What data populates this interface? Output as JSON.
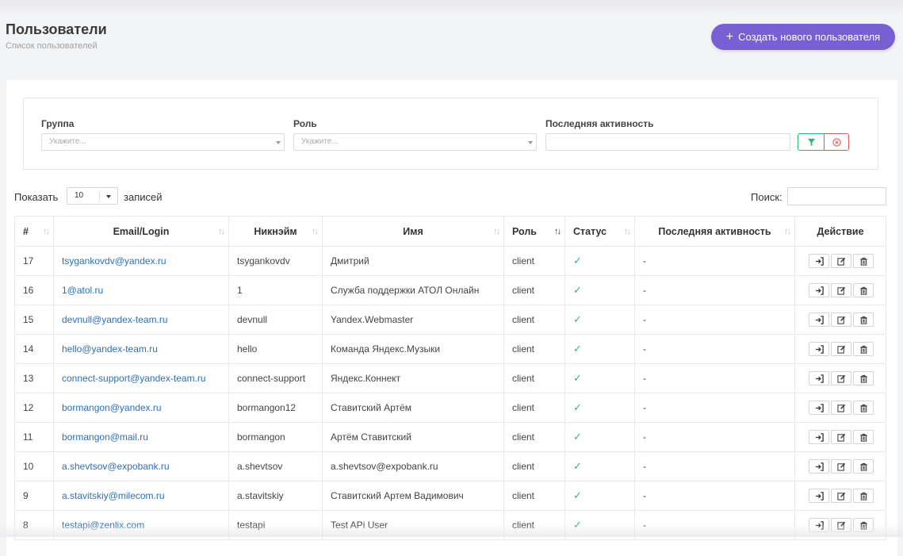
{
  "header": {
    "title": "Пользователи",
    "subtitle": "Список пользователей",
    "create_button": "Создать нового пользователя",
    "create_icon": "+"
  },
  "filters": {
    "group_label": "Группа",
    "group_placeholder": "Укажите...",
    "role_label": "Роль",
    "role_placeholder": "Укажите...",
    "activity_label": "Последняя активность"
  },
  "table_controls": {
    "show_label": "Показать",
    "page_size": "10",
    "records_label": "записей",
    "search_label": "Поиск:"
  },
  "colors": {
    "accent": "#7a5ed3",
    "link": "#2e6fb7",
    "success": "#2bb673",
    "danger": "#e05a5a"
  },
  "table": {
    "headers": [
      "#",
      "Email/Login",
      "Никнэйм",
      "Имя",
      "Роль",
      "Статус",
      "Последняя активность",
      "Действие"
    ],
    "rows": [
      {
        "id": "17",
        "email": "tsygankovdv@yandex.ru",
        "nick": "tsygankovdv",
        "name": "Дмитрий",
        "role": "client",
        "status": "✓",
        "activity": "-"
      },
      {
        "id": "16",
        "email": "1@atol.ru",
        "nick": "1",
        "name": "Служба поддержки АТОЛ Онлайн",
        "role": "client",
        "status": "✓",
        "activity": "-"
      },
      {
        "id": "15",
        "email": "devnull@yandex-team.ru",
        "nick": "devnull",
        "name": "Yandex.Webmaster",
        "role": "client",
        "status": "✓",
        "activity": "-"
      },
      {
        "id": "14",
        "email": "hello@yandex-team.ru",
        "nick": "hello",
        "name": "Команда Яндекс.Музыки",
        "role": "client",
        "status": "✓",
        "activity": "-"
      },
      {
        "id": "13",
        "email": "connect-support@yandex-team.ru",
        "nick": "connect-support",
        "name": "Яндекс.Коннект",
        "role": "client",
        "status": "✓",
        "activity": "-"
      },
      {
        "id": "12",
        "email": "bormangon@yandex.ru",
        "nick": "bormangon12",
        "name": "Ставитский Артём",
        "role": "client",
        "status": "✓",
        "activity": "-"
      },
      {
        "id": "11",
        "email": "bormangon@mail.ru",
        "nick": "bormangon",
        "name": "Артём Ставитский",
        "role": "client",
        "status": "✓",
        "activity": "-"
      },
      {
        "id": "10",
        "email": "a.shevtsov@expobank.ru",
        "nick": "a.shevtsov",
        "name": "a.shevtsov@expobank.ru",
        "role": "client",
        "status": "✓",
        "activity": "-"
      },
      {
        "id": "9",
        "email": "a.stavitskiy@milecom.ru",
        "nick": "a.stavitskiy",
        "name": "Ставитский Артем Вадимович",
        "role": "client",
        "status": "✓",
        "activity": "-"
      },
      {
        "id": "8",
        "email": "testapi@zenlix.com",
        "nick": "testapi",
        "name": "Test APi User",
        "role": "client",
        "status": "✓",
        "activity": "-"
      }
    ],
    "row_actions": [
      "login-icon",
      "edit-icon",
      "trash-icon"
    ]
  }
}
